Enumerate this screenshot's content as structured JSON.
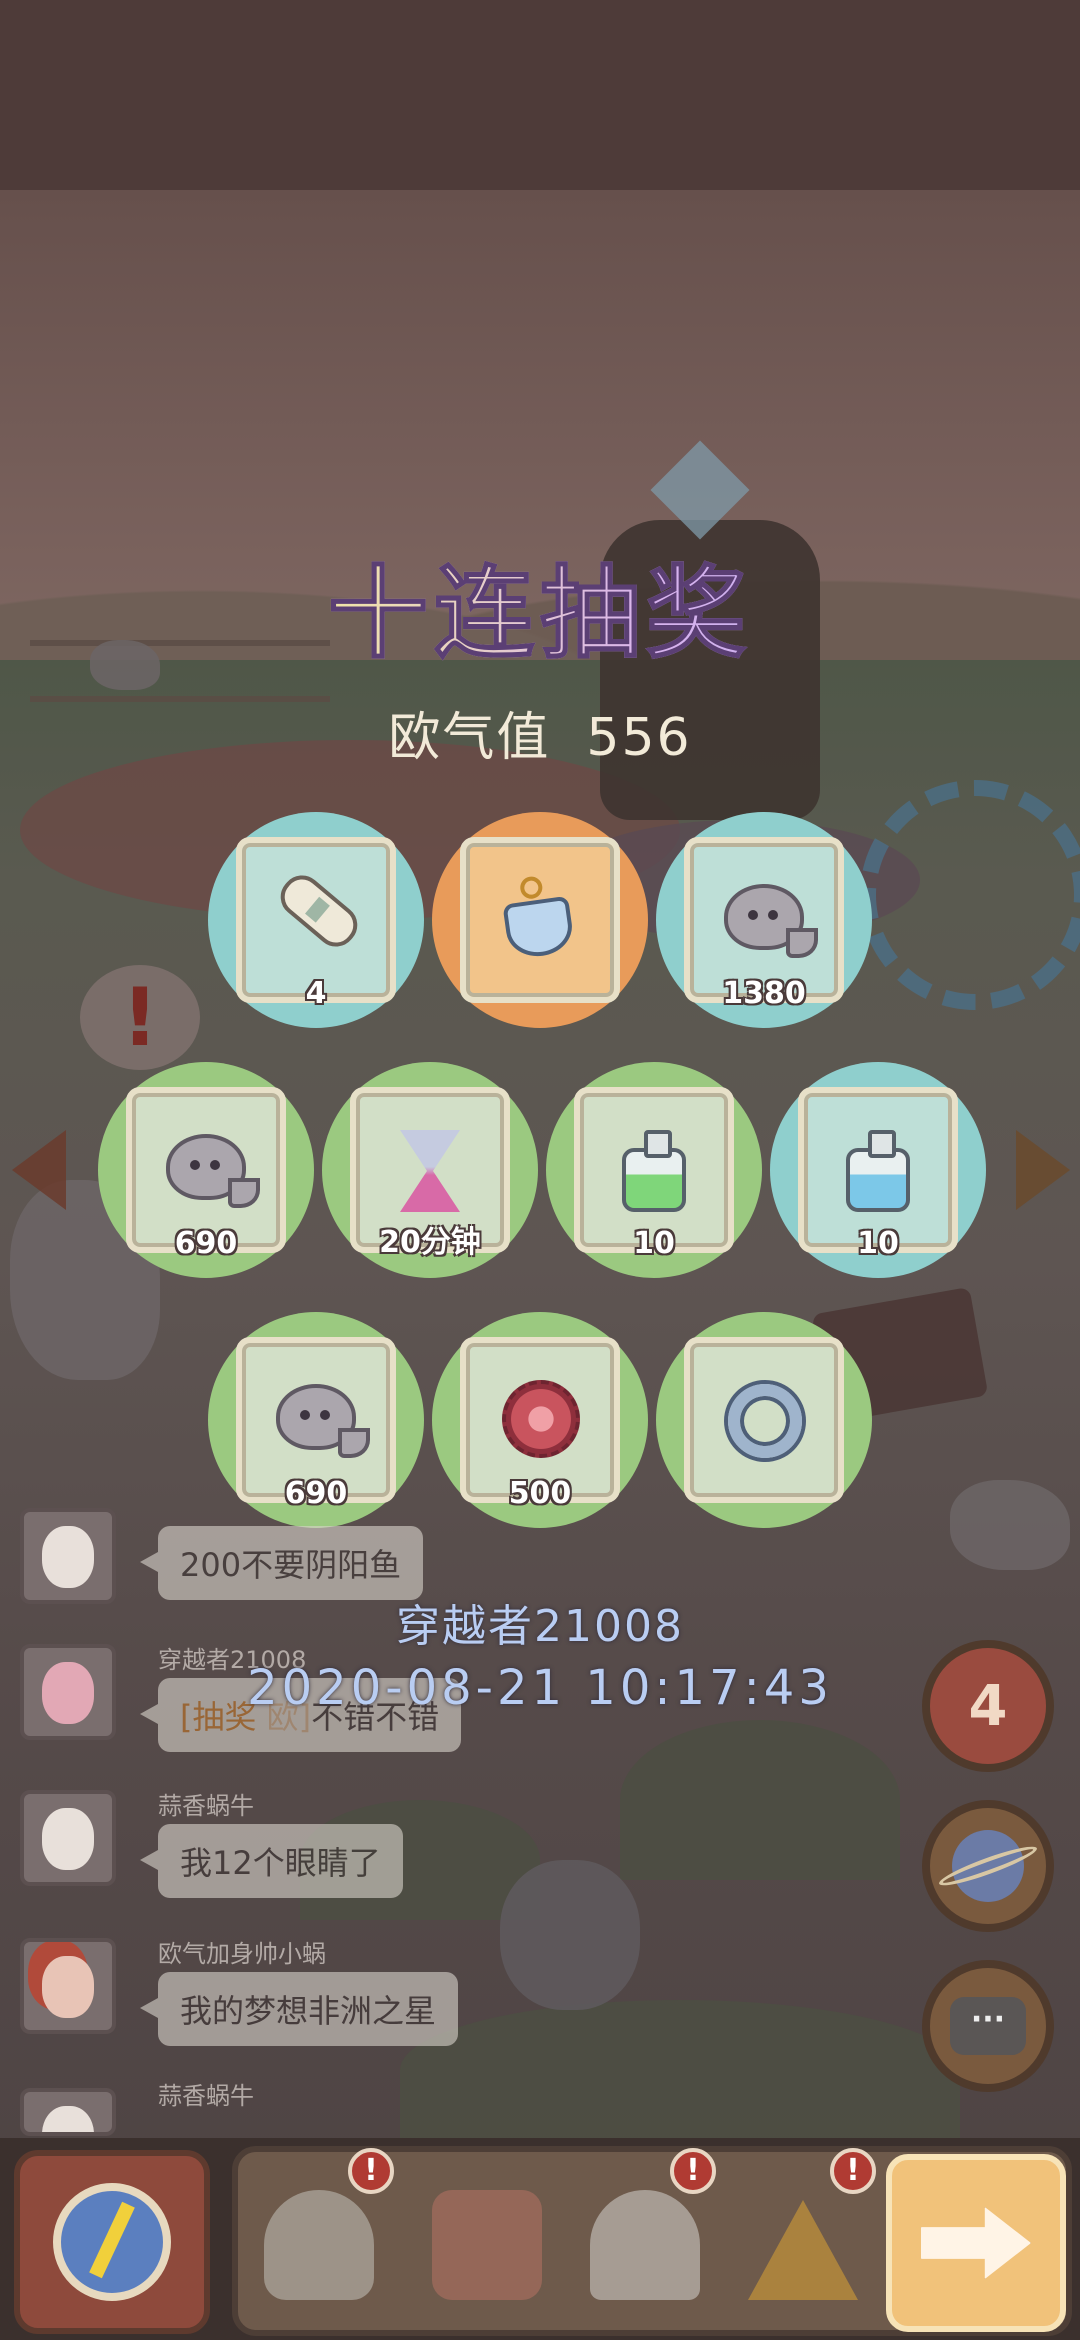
{
  "title": "十连抽奖",
  "luck": {
    "label": "欧气值",
    "value": "556"
  },
  "rewards": [
    {
      "icon": "scroll-icon",
      "qty": "4",
      "rarity": "blue"
    },
    {
      "icon": "heart-gem-pendant-icon",
      "qty": "",
      "rarity": "orange"
    },
    {
      "icon": "ghost-blob-icon",
      "qty": "1380",
      "rarity": "blue"
    },
    {
      "icon": "ghost-blob-icon",
      "qty": "690",
      "rarity": "green"
    },
    {
      "icon": "hourglass-icon",
      "qty": "20分钟",
      "rarity": "green"
    },
    {
      "icon": "green-potion-bottle-icon",
      "qty": "10",
      "rarity": "green"
    },
    {
      "icon": "blue-potion-bottle-icon",
      "qty": "10",
      "rarity": "blue"
    },
    {
      "icon": "ghost-blob-icon",
      "qty": "690",
      "rarity": "green"
    },
    {
      "icon": "sea-urchin-icon",
      "qty": "500",
      "rarity": "green"
    },
    {
      "icon": "claw-ring-icon",
      "qty": "",
      "rarity": "green"
    }
  ],
  "chat": [
    {
      "name": "",
      "message": "200不要阴阳鱼"
    },
    {
      "name": "穿越者21008",
      "message_tag": "[抽奖",
      "message_hidden": "欧]",
      "message": "不错不错"
    },
    {
      "name": "蒜香蜗牛",
      "message": "我12个眼睛了"
    },
    {
      "name": "欧气加身帅小蜗",
      "message": "我的梦想非洲之星"
    },
    {
      "name": "蒜香蜗牛",
      "message": ""
    }
  ],
  "winner": {
    "name": "穿越者21008",
    "time": "2020-08-21  10:17:43"
  },
  "side": {
    "timer_value": "4",
    "chat_glyph": "···"
  },
  "bottom": {
    "badge": "!"
  },
  "colors": {
    "blue": "#8fcfcd",
    "green": "#9bc980",
    "orange": "#e89b5a",
    "accent": "#f1c27a"
  }
}
